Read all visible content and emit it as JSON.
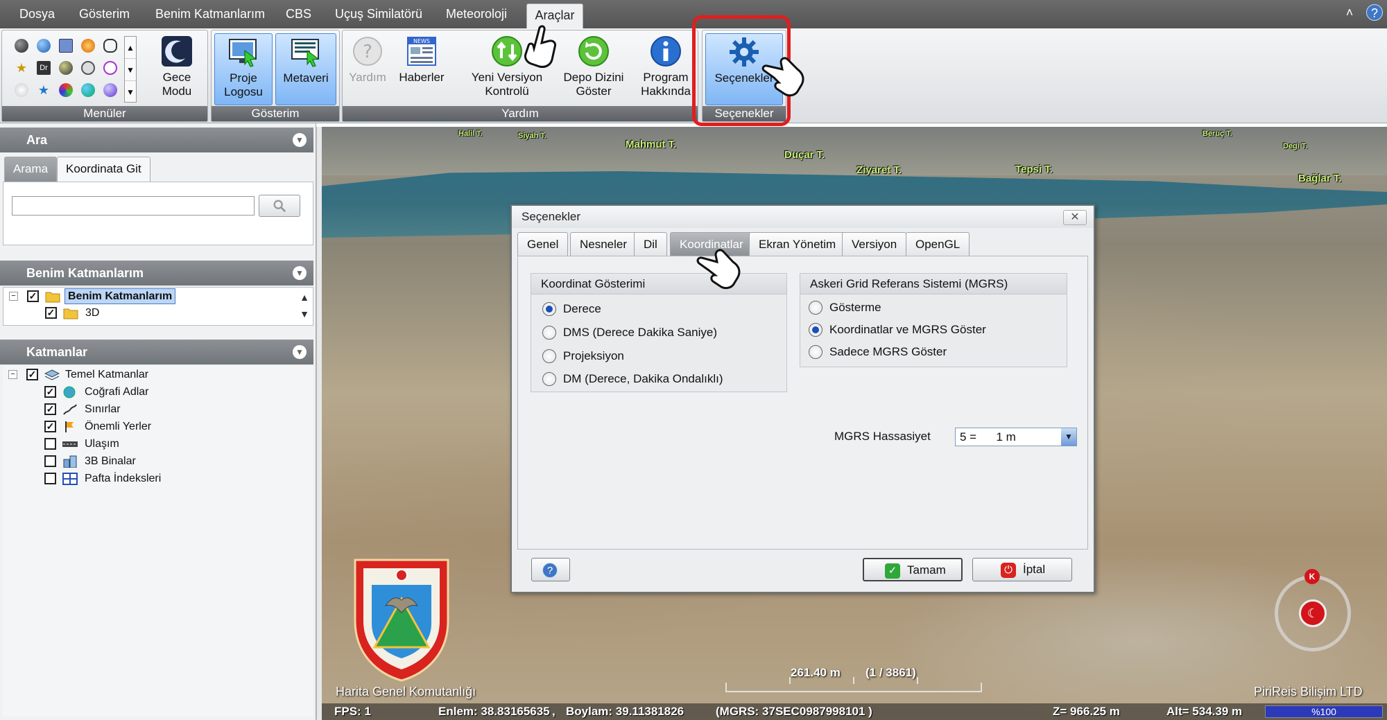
{
  "menubar": {
    "tabs": [
      {
        "label": "Dosya",
        "active": false
      },
      {
        "label": "Gösterim",
        "active": false
      },
      {
        "label": "Benim Katmanlarım",
        "active": false
      },
      {
        "label": "CBS",
        "active": false
      },
      {
        "label": "Uçuş Similatörü",
        "active": false
      },
      {
        "label": "Meteoroloji",
        "active": false
      },
      {
        "label": "Araçlar",
        "active": true
      }
    ],
    "help": "?",
    "collapse": "˄"
  },
  "ribbon": {
    "menus_group_label": "Menüler",
    "night_mode_label": "Gece Modu",
    "gosterim_group_label": "Gösterim",
    "project_logo_label": "Proje Logosu",
    "metadata_label": "Metaveri",
    "help_group_label": "Yardım",
    "help_label": "Yardım",
    "news_label": "Haberler",
    "new_version_label": "Yeni Versiyon Kontrolü",
    "repo_dir_label": "Depo Dizini Göster",
    "about_label": "Program Hakkında",
    "options_label": "Seçenekler",
    "options_group_label": "Seçenekler",
    "news_icon_text": "NEWS"
  },
  "search_panel": {
    "title": "Ara",
    "tabs": [
      "Arama",
      "Koordinata Git"
    ],
    "search_value": ""
  },
  "my_layers_panel": {
    "title": "Benim Katmanlarım",
    "items": [
      {
        "label": "Benim Katmanlarım",
        "checked": true
      },
      {
        "label": "3D",
        "checked": true
      }
    ]
  },
  "layers_panel": {
    "title": "Katmanlar",
    "root": {
      "label": "Temel Katmanlar",
      "checked": true
    },
    "items": [
      {
        "label": "Coğrafi Adlar",
        "checked": true
      },
      {
        "label": "Sınırlar",
        "checked": true
      },
      {
        "label": "Önemli Yerler",
        "checked": true
      },
      {
        "label": "Ulaşım",
        "checked": false
      },
      {
        "label": "3B Binalar",
        "checked": false
      },
      {
        "label": "Pafta İndeksleri",
        "checked": false
      }
    ]
  },
  "map": {
    "places": [
      "Halil T.",
      "Siyah T.",
      "Mahmut T.",
      "Duçar T.",
      "Ziyaret T.",
      "Tepsi T.",
      "Beruç T.",
      "Degi T.",
      "Bağlar T."
    ],
    "org_label": "Harita Genel Komutanlığı",
    "company_label": "PiriReis Bilişim LTD",
    "scale_text": "261.40 m",
    "scale_ratio": "(1 / 3861)",
    "compass_north": "K",
    "status": {
      "fps": "FPS: 1",
      "lat": "Enlem: 38.83165635",
      "sep": ",",
      "lon": "Boylam: 39.11381826",
      "mgrs": "(MGRS: 37SEC0987998101 )",
      "z": "Z= 966.25 m",
      "alt": "Alt= 534.39 m",
      "progress": "%100"
    }
  },
  "dialog": {
    "title": "Seçenekler",
    "close": "✕",
    "tabs": [
      {
        "label": "Genel",
        "active": false
      },
      {
        "label": "Nesneler",
        "active": false
      },
      {
        "label": "Dil",
        "active": false
      },
      {
        "label": "Koordinatlar",
        "active": true
      },
      {
        "label": "Ekran Yönetim",
        "active": false
      },
      {
        "label": "Versiyon",
        "active": false
      },
      {
        "label": "OpenGL",
        "active": false
      }
    ],
    "coord_group": {
      "title": "Koordinat Gösterimi",
      "options": [
        {
          "label": "Derece",
          "selected": true
        },
        {
          "label": "DMS (Derece Dakika Saniye)",
          "selected": false
        },
        {
          "label": "Projeksiyon",
          "selected": false
        },
        {
          "label": "DM (Derece, Dakika Ondalıklı)",
          "selected": false
        }
      ]
    },
    "mgrs_group": {
      "title": "Askeri Grid Referans Sistemi (MGRS)",
      "options": [
        {
          "label": "Gösterme",
          "selected": false
        },
        {
          "label": "Koordinatlar ve MGRS Göster",
          "selected": true
        },
        {
          "label": "Sadece MGRS Göster",
          "selected": false
        }
      ]
    },
    "mgrs_precision_label": "MGRS Hassasiyet",
    "mgrs_precision_value": "5 =      1 m",
    "help_button": "?",
    "ok_label": "Tamam",
    "cancel_label": "İptal"
  },
  "colors": {
    "highlight": "#e01e1e",
    "accent_blue": "#4b88d6",
    "place_label": "#c8f07a"
  }
}
